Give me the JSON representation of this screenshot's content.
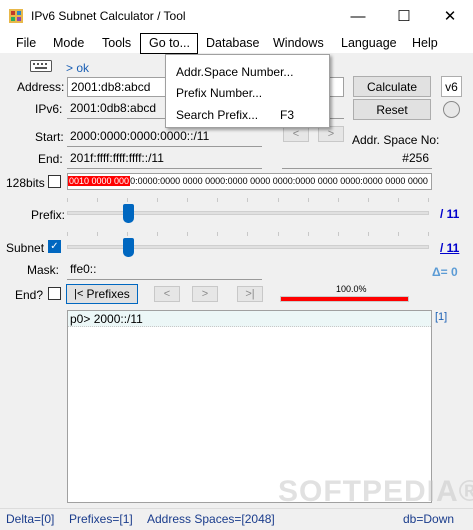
{
  "window": {
    "title": "IPv6 Subnet Calculator / Tool",
    "minimize": "—",
    "maximize": "☐",
    "close": "✕"
  },
  "menu": {
    "items": [
      "File",
      "Mode",
      "Tools",
      "Go to...",
      "Database",
      "Windows",
      "Language",
      "Help"
    ],
    "goto_dropdown": [
      {
        "label": "Addr.Space Number...",
        "shortcut": ""
      },
      {
        "label": "Prefix Number...",
        "shortcut": ""
      },
      {
        "label": "Search Prefix...",
        "shortcut": "F3"
      }
    ]
  },
  "keyboard": {
    "icon": "keyboard-icon",
    "status": "> ok"
  },
  "form": {
    "address_label": "Address:",
    "address_value": "2001:db8:abcd",
    "ipv6_label": "IPv6:",
    "ipv6_value": "2001:0db8:abcd",
    "start_label": "Start:",
    "start_value": "2000:0000:0000:0000::/11",
    "end_label": "End:",
    "end_value": "201f:ffff:ffff:ffff::/11",
    "addr_space_label": "Addr. Space No:",
    "addr_space_value": "#256",
    "bits128_label": "128bits",
    "bits_highlight": "0010 0000 000",
    "bits_rest": "0:0000:0000 0000 0000:0000 0000 0000:0000 0000 0000:0000 0000 0000",
    "prefix_label": "Prefix:",
    "prefix_value": "/ 11",
    "subnet_label": "Subnet",
    "subnet_value": "/ 11",
    "delta_label": "Δ= 0",
    "mask_label": "Mask:",
    "mask_value": "ffe0::",
    "end_check_label": "End?",
    "prefixes_button": "Prefixes",
    "progress_text": "100.0%",
    "progress_fraction": 1.0
  },
  "buttons": {
    "calculate": "Calculate",
    "reset": "Reset",
    "v6": "v6"
  },
  "nav": {
    "prev": "<",
    "next": ">",
    "first": "|<",
    "prev2": "<",
    "next2": ">",
    "last": ">|"
  },
  "results": {
    "rows": [
      "p0> 2000::/11"
    ],
    "count": "[1]"
  },
  "status": {
    "delta": "Delta=[0]",
    "prefixes": "Prefixes=[1]",
    "address_spaces": "Address Spaces=[2048]",
    "db": "db=Down"
  },
  "watermark": "SOFTPEDIA®",
  "colors": {
    "accent": "#0067c0",
    "highlight_red": "#ff0000",
    "link_blue": "#0000cc",
    "status_blue": "#1a3c8c"
  }
}
